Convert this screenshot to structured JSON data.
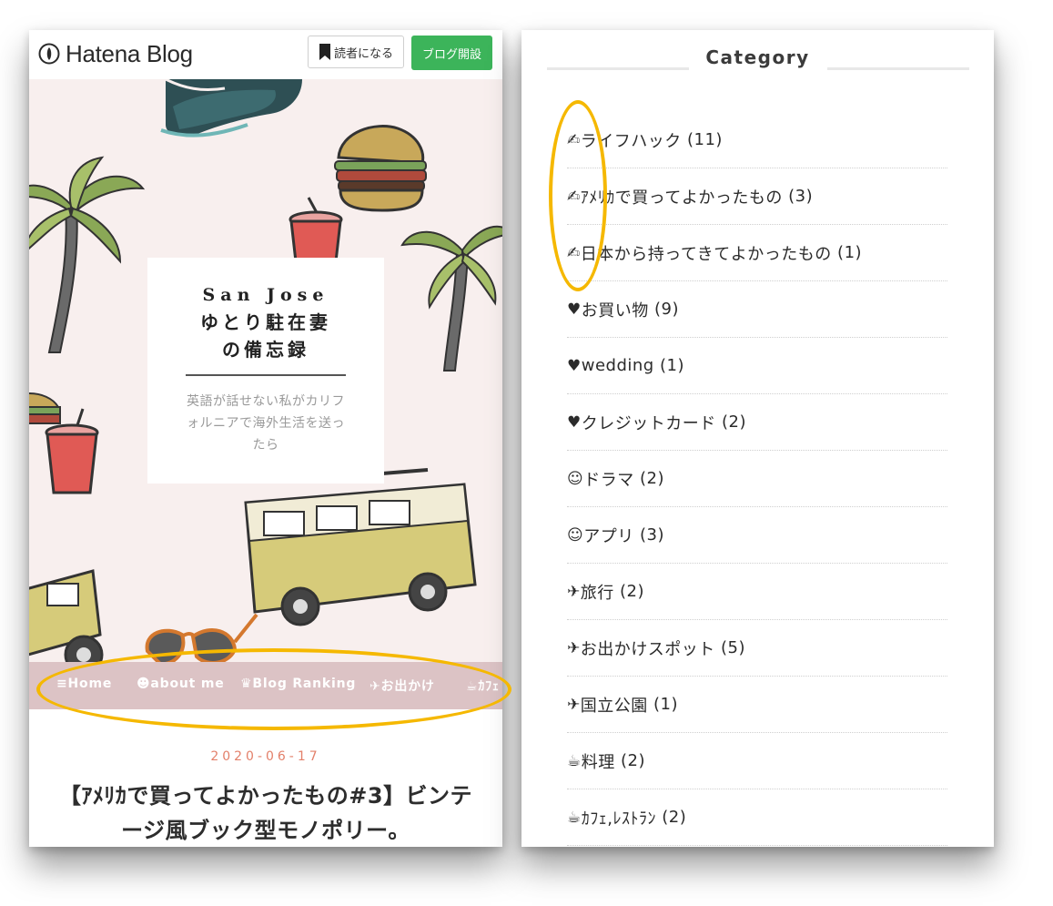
{
  "header": {
    "logo_text": "Hatena Blog",
    "subscribe_label": "読者になる",
    "open_blog_label": "ブログ開設",
    "brand_green": "#3cb45a"
  },
  "hero": {
    "title_line1": "San Jose",
    "title_line2": "ゆとり駐在妻",
    "title_line3": "の備忘録",
    "subtitle": "英語が話せない私がカリフォルニアで海外生活を送ったら",
    "background_color": "#f8efee"
  },
  "nav": {
    "items": [
      {
        "icon": "≡",
        "label": "Home"
      },
      {
        "icon": "☻",
        "label": "about me"
      },
      {
        "icon": "♛",
        "label": "Blog Ranking"
      },
      {
        "icon": "✈",
        "label": "お出かけ"
      },
      {
        "icon": "☕",
        "label": "ｶﾌｪ"
      }
    ],
    "background_color": "#dcc3c5"
  },
  "post": {
    "date": "2020-06-17",
    "title": "【ｱﾒﾘｶで買ってよかったもの#3】ビンテージ風ブック型モノポリー。"
  },
  "sidebar": {
    "heading": "Category",
    "categories": [
      {
        "icon": "✍",
        "label": "ライフハック",
        "count": "(11)"
      },
      {
        "icon": "✍",
        "label": "ｱﾒﾘｶで買ってよかったもの",
        "count": "(3)"
      },
      {
        "icon": "✍",
        "label": "日本から持ってきてよかったもの",
        "count": "(1)"
      },
      {
        "icon": "♥",
        "label": "お買い物",
        "count": "(9)"
      },
      {
        "icon": "♥",
        "label": "wedding",
        "count": "(1)"
      },
      {
        "icon": "♥",
        "label": "クレジットカード",
        "count": "(2)"
      },
      {
        "icon": "☺",
        "label": "ドラマ",
        "count": "(2)"
      },
      {
        "icon": "☺",
        "label": "アプリ",
        "count": "(3)"
      },
      {
        "icon": "✈",
        "label": "旅行",
        "count": "(2)"
      },
      {
        "icon": "✈",
        "label": "お出かけスポット",
        "count": "(5)"
      },
      {
        "icon": "✈",
        "label": "国立公園",
        "count": "(1)"
      },
      {
        "icon": "☕",
        "label": "料理",
        "count": "(2)"
      },
      {
        "icon": "☕",
        "label": "ｶﾌｪ,ﾚｽﾄﾗﾝ",
        "count": "(2)"
      }
    ]
  },
  "annotations": {
    "highlight_color": "#f5b800"
  }
}
